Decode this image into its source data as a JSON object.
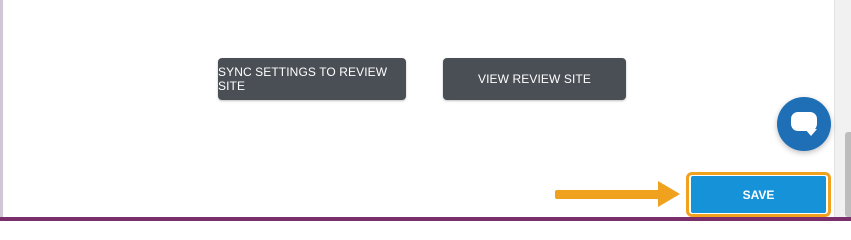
{
  "actions": {
    "sync_label": "SYNC SETTINGS TO REVIEW SITE",
    "view_label": "VIEW REVIEW SITE"
  },
  "footer": {
    "save_label": "SAVE"
  },
  "icons": {
    "chat": "chat-bubble-icon",
    "arrow": "arrow-right-icon"
  },
  "colors": {
    "dark_button": "#4a4e55",
    "save_button": "#1592d8",
    "highlight": "#f0a11e",
    "chat_widget": "#1f6fb6",
    "frame_accent": "#7a2f6a"
  }
}
